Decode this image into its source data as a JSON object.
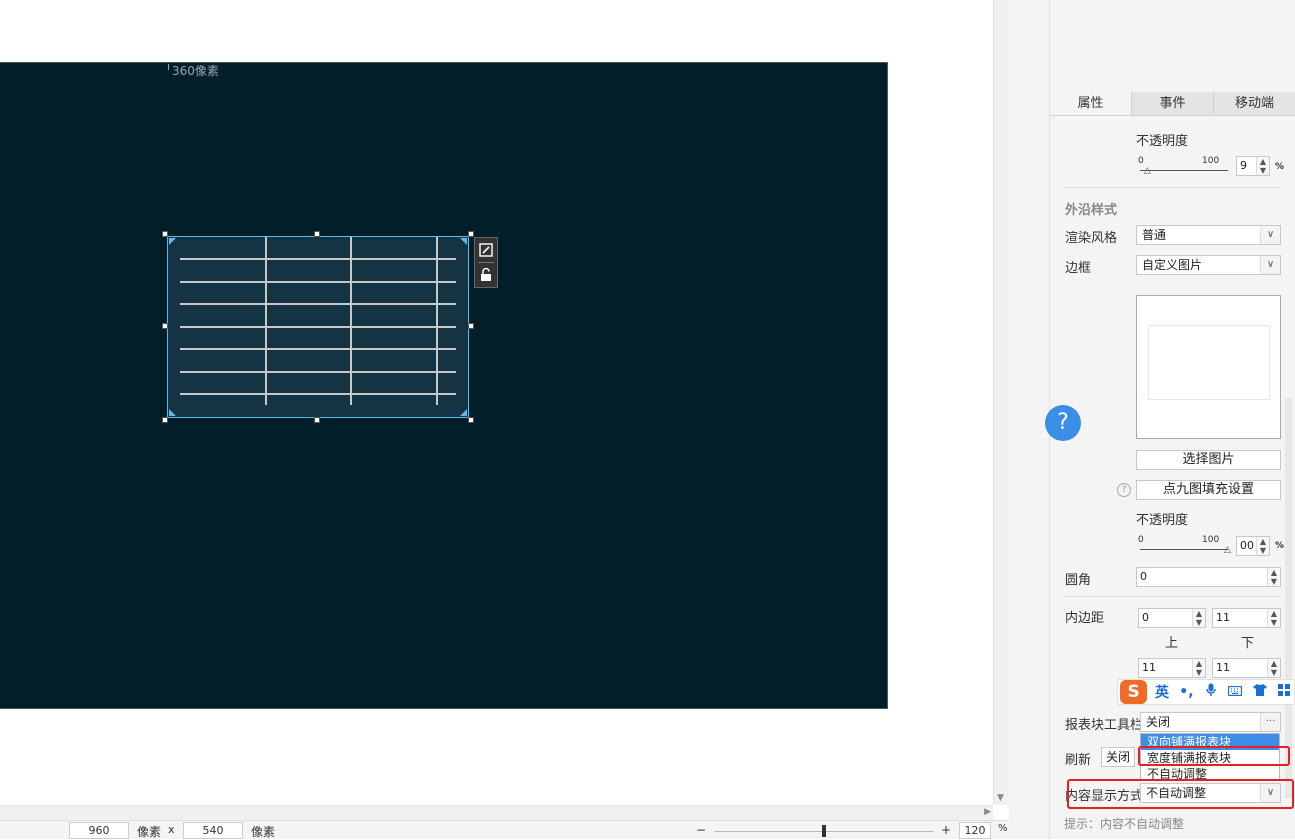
{
  "canvas": {
    "ruler_label": "360像素",
    "background_color": "#021e29",
    "table_block": {
      "border_color": "#5fb8e8",
      "fill_color": "#143443",
      "grid_color": "#c8c8c8"
    },
    "mini_toolbar": {
      "edit_icon": "edit-icon",
      "lock_icon": "unlock-icon"
    }
  },
  "statusbar": {
    "width_value": "960",
    "width_unit": "像素",
    "times": "x",
    "height_value": "540",
    "height_unit": "像素",
    "zoom_minus": "−",
    "zoom_plus": "+",
    "zoom_value": "120",
    "zoom_unit": "%"
  },
  "panel": {
    "tabs": [
      {
        "label": "属性",
        "active": true
      },
      {
        "label": "事件",
        "active": false
      },
      {
        "label": "移动端",
        "active": false
      }
    ],
    "opacity1": {
      "label": "不透明度",
      "min": "0",
      "max": "100",
      "value": "9",
      "unit": "%",
      "level_fraction": 0.09
    },
    "outer_style": {
      "section_title": "外沿样式",
      "render_style_label": "渲染风格",
      "render_style_value": "普通",
      "border_label": "边框",
      "border_value": "自定义图片"
    },
    "select_image_button": "选择图片",
    "ninepatch_button": "点九图填充设置",
    "opacity2": {
      "label": "不透明度",
      "min": "0",
      "max": "100",
      "value": "00",
      "unit": "%",
      "level_fraction": 1.0
    },
    "corner": {
      "label": "圆角",
      "value": "0"
    },
    "padding": {
      "label": "内边距",
      "top_value": "0",
      "bottom_value": "11",
      "top_label": "上",
      "bottom_label": "下",
      "left_value": "11",
      "right_value": "11"
    },
    "report_toolbar": {
      "label": "报表块工具栏",
      "value": "关闭",
      "more": "···"
    },
    "refresh": {
      "label": "刷新",
      "value": "关闭"
    },
    "dropdown_options": [
      "双向铺满报表块",
      "宽度铺满报表块",
      "不自动调整"
    ],
    "content_display": {
      "label": "内容显示方式",
      "value": "不自动调整"
    },
    "hint": "提示：内容不自动调整"
  },
  "help_bubble": "?",
  "ime": {
    "logo": "S",
    "lang": "英",
    "punct": "•,",
    "mic_icon": "microphone-icon",
    "keyboard_icon": "keyboard-icon",
    "skin_icon": "shirt-icon",
    "apps_icon": "grid-icon"
  }
}
